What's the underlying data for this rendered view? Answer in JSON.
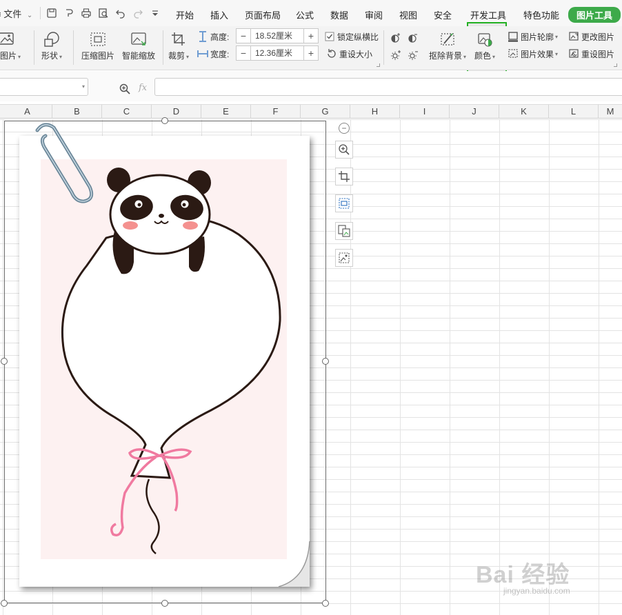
{
  "menubar": {
    "file_label": "≡ 文件",
    "tabs": [
      "开始",
      "插入",
      "页面布局",
      "公式",
      "数据",
      "审阅",
      "视图",
      "安全",
      "开发工具",
      "特色功能",
      "图片工具"
    ]
  },
  "ribbon": {
    "insert_picture": "入图片",
    "shape": "形状",
    "compress_picture": "压缩图片",
    "smart_scale": "智能缩放",
    "crop": "裁剪",
    "height_label": "高度:",
    "height_value": "18.52厘米",
    "width_label": "宽度:",
    "width_value": "12.36厘米",
    "lock_ratio": "锁定纵横比",
    "reset_size": "重设大小",
    "remove_background": "抠除背景",
    "color": "颜色",
    "picture_outline": "图片轮廓",
    "picture_effects": "图片效果",
    "change_picture": "更改图片",
    "reset_picture": "重设图片",
    "lock_ratio_checked": true
  },
  "formula_bar": {
    "fx_label": "fx",
    "name_value": "",
    "formula_value": ""
  },
  "columns": [
    "A",
    "B",
    "C",
    "D",
    "E",
    "F",
    "G",
    "H",
    "I",
    "J",
    "K",
    "L",
    "M"
  ],
  "colors": {
    "accent_green": "#3daa4a",
    "highlight_border": "#22b022",
    "ribbon_bg": "#f3f3f3",
    "pink_bg": "#fdf1f1",
    "ribbon_pink": "#f07aa0"
  },
  "watermark": {
    "text": "Bai 经验",
    "subtext": "jingyan.baidu.com"
  }
}
